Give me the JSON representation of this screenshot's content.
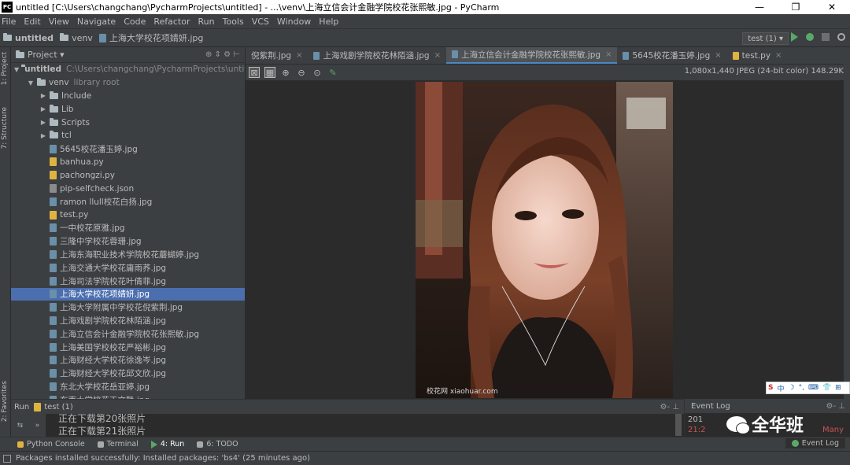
{
  "window": {
    "title": "untitled [C:\\Users\\changchang\\PycharmProjects\\untitled] - ...\\venv\\上海立信会计金融学院校花张熙敏.jpg - PyCharm",
    "app_icon_text": "PC",
    "minimize": "—",
    "maximize": "❐",
    "close": "✕"
  },
  "menu": [
    "File",
    "Edit",
    "View",
    "Navigate",
    "Code",
    "Refactor",
    "Run",
    "Tools",
    "VCS",
    "Window",
    "Help"
  ],
  "navbar": {
    "crumbs": [
      {
        "label": "untitled",
        "icon": "folder-icon"
      },
      {
        "label": "venv",
        "icon": "folder-icon"
      },
      {
        "label": "上海大学校花项婧妍.jpg",
        "icon": "image-file-icon"
      }
    ],
    "run_config": "test (1) ▾"
  },
  "left_stripe": {
    "project_tab": "1: Project",
    "structure_tab": "7: Structure",
    "favorites_tab": "2: Favorites"
  },
  "project_panel": {
    "title": "Project ▾",
    "head_icons": "⊕ ⇕ ⚙ ⊢",
    "rows": [
      {
        "indent": 0,
        "arrow": "▼",
        "icon": "folder",
        "label": "untitled",
        "extra": "C:\\Users\\changchang\\PycharmProjects\\untitled",
        "bold": true
      },
      {
        "indent": 1,
        "arrow": "▼",
        "icon": "folder",
        "label": "venv",
        "extra": "library root"
      },
      {
        "indent": 2,
        "arrow": "▶",
        "icon": "folder",
        "label": "Include"
      },
      {
        "indent": 2,
        "arrow": "▶",
        "icon": "folder",
        "label": "Lib"
      },
      {
        "indent": 2,
        "arrow": "▶",
        "icon": "folder",
        "label": "Scripts"
      },
      {
        "indent": 2,
        "arrow": "▶",
        "icon": "folder",
        "label": "tcl"
      },
      {
        "indent": 2,
        "arrow": "",
        "icon": "img",
        "label": "5645校花潘玉婷.jpg"
      },
      {
        "indent": 2,
        "arrow": "",
        "icon": "py",
        "label": "banhua.py"
      },
      {
        "indent": 2,
        "arrow": "",
        "icon": "py",
        "label": "pachongzi.py"
      },
      {
        "indent": 2,
        "arrow": "",
        "icon": "json",
        "label": "pip-selfcheck.json"
      },
      {
        "indent": 2,
        "arrow": "",
        "icon": "img",
        "label": "ramon llull校花白扬.jpg"
      },
      {
        "indent": 2,
        "arrow": "",
        "icon": "py",
        "label": "test.py"
      },
      {
        "indent": 2,
        "arrow": "",
        "icon": "img",
        "label": "一中校花原雅.jpg"
      },
      {
        "indent": 2,
        "arrow": "",
        "icon": "img",
        "label": "三隆中学校花蓉珊.jpg"
      },
      {
        "indent": 2,
        "arrow": "",
        "icon": "img",
        "label": "上海东海职业技术学院校花蘑蝴婷.jpg"
      },
      {
        "indent": 2,
        "arrow": "",
        "icon": "img",
        "label": "上海交通大学校花庸雨荞.jpg"
      },
      {
        "indent": 2,
        "arrow": "",
        "icon": "img",
        "label": "上海司法学院校花叶倩菲.jpg"
      },
      {
        "indent": 2,
        "arrow": "",
        "icon": "img",
        "label": "上海大学校花项婧妍.jpg",
        "selected": true
      },
      {
        "indent": 2,
        "arrow": "",
        "icon": "img",
        "label": "上海大学附属中学校花倪紫荆.jpg"
      },
      {
        "indent": 2,
        "arrow": "",
        "icon": "img",
        "label": "上海戏剧学院校花林陌涵.jpg"
      },
      {
        "indent": 2,
        "arrow": "",
        "icon": "img",
        "label": "上海立信会计金融学院校花张熙敏.jpg"
      },
      {
        "indent": 2,
        "arrow": "",
        "icon": "img",
        "label": "上海美国学校校花严裕彬.jpg"
      },
      {
        "indent": 2,
        "arrow": "",
        "icon": "img",
        "label": "上海财经大学校花徐逸岑.jpg"
      },
      {
        "indent": 2,
        "arrow": "",
        "icon": "img",
        "label": "上海财经大学校花邱文欣.jpg"
      },
      {
        "indent": 2,
        "arrow": "",
        "icon": "img",
        "label": "东北大学校花岳亚婷.jpg"
      },
      {
        "indent": 2,
        "arrow": "",
        "icon": "img",
        "label": "东南大学校花王文静.jpg"
      }
    ]
  },
  "tabs": [
    {
      "label": "倪紫荆.jpg",
      "icon": "img",
      "active": false
    },
    {
      "label": "上海戏剧学院校花林陌涵.jpg",
      "icon": "img",
      "active": false
    },
    {
      "label": "上海立信会计金融学院校花张熙敏.jpg",
      "icon": "img",
      "active": true
    },
    {
      "label": "5645校花潘玉婷.jpg",
      "icon": "img",
      "active": false
    },
    {
      "label": "test.py",
      "icon": "py",
      "active": false
    }
  ],
  "image_toolbar": {
    "info": "1,080x1,440 JPEG (24-bit color) 148.29K"
  },
  "photo": {
    "watermark": "校花网 xiaohuar.com"
  },
  "ime_bar": {
    "items": [
      "S",
      "中",
      "☽",
      "°,",
      "⌨",
      "👕",
      "⊞"
    ]
  },
  "run_panel": {
    "title": "Run",
    "config": "test (1)",
    "head_icons": "⚙- ⊥",
    "output": [
      "正在下载第20张照片",
      "正在下载第21张照片"
    ],
    "left_icons": [
      "⇆",
      "»"
    ]
  },
  "event_panel": {
    "title": "Event Log",
    "head_icons": "⚙- ⊥",
    "lines": [
      "201",
      "21:2"
    ],
    "many_text": "Many",
    "account_name": "全华班"
  },
  "bottom_tabs": [
    {
      "label": "Python Console",
      "active": false,
      "color": "#e0b341"
    },
    {
      "label": "Terminal",
      "active": false,
      "color": "#aaaaaa"
    },
    {
      "label": "4: Run",
      "active": true,
      "color": "#59a869"
    },
    {
      "label": "6: TODO",
      "active": false,
      "color": "#aaaaaa"
    }
  ],
  "event_log_button": "Event Log",
  "status": "Packages installed successfully: Installed packages: 'bs4' (25 minutes ago)"
}
